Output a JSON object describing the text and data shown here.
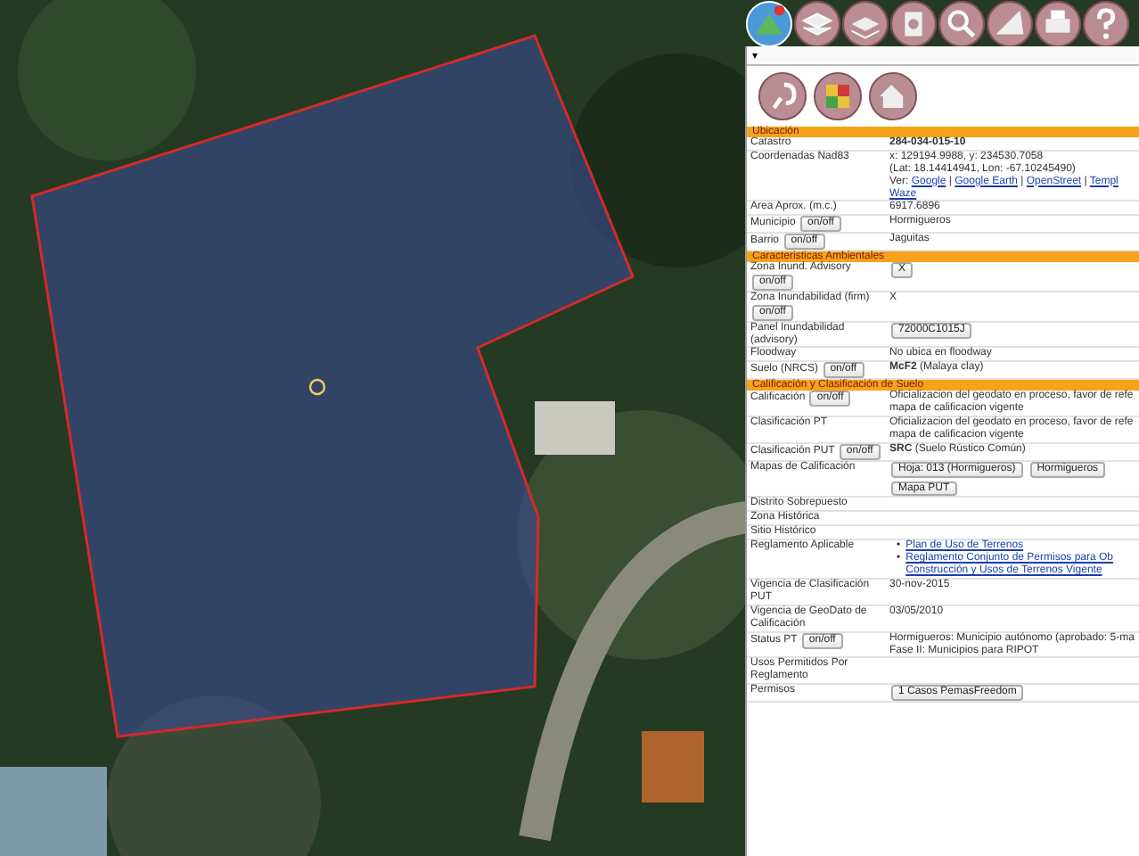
{
  "panel": {
    "dropdown_marker": "▾",
    "sections": [
      {
        "title": "Ubicación",
        "rows": [
          {
            "label": "Catastro",
            "kind": "text",
            "bold": true,
            "value": "284-034-015-10"
          },
          {
            "label": "Coordenadas Nad83",
            "kind": "coords",
            "lines": [
              "x: 129194.9988, y: 234530.7058",
              "(Lat: 18.14414941, Lon: -67.10245490)"
            ],
            "links_prefix": "Ver:",
            "links_separator": "|",
            "links": [
              "Google",
              "Google Earth",
              "OpenStreet",
              "Templ",
              "Waze"
            ]
          },
          {
            "label": "Area Aprox. (m.c.)",
            "kind": "text",
            "value": "6917.6896"
          },
          {
            "label": "Municipio",
            "toggle": "on/off",
            "kind": "text",
            "value": "Hormigueros"
          },
          {
            "label": "Barrio",
            "toggle": "on/off",
            "kind": "text",
            "value": "Jaguitas"
          }
        ]
      },
      {
        "title": "Caracteristicas Ambientales",
        "rows": [
          {
            "label": "Zona Inund. Advisory",
            "toggle": "on/off",
            "kind": "buttons",
            "buttons": [
              "X"
            ]
          },
          {
            "label": "Zona Inundabilidad (firm)",
            "toggle": "on/off",
            "kind": "text",
            "value": "X"
          },
          {
            "label": "Panel Inundabilidad (advisory)",
            "kind": "buttons",
            "buttons": [
              "72000C1015J"
            ]
          },
          {
            "label": "Floodway",
            "kind": "text",
            "value": "No ubica en floodway"
          },
          {
            "label": "Suelo (NRCS)",
            "toggle": "on/off",
            "kind": "text",
            "value": "**McF2** (Malaya clay)"
          }
        ]
      },
      {
        "title": "Calificación y Clasificación de Suelo",
        "rows": [
          {
            "label": "Calificación",
            "toggle": "on/off",
            "kind": "lines",
            "lines": [
              "Oficializacion del geodato en proceso, favor de refe",
              "mapa de calificacion vigente"
            ]
          },
          {
            "label": "Clasificación PT",
            "kind": "lines",
            "lines": [
              "Oficializacion del geodato en proceso, favor de refe",
              "mapa de calificacion vigente"
            ]
          },
          {
            "label": "Clasificación PUT",
            "toggle": "on/off",
            "kind": "text",
            "value": "**SRC** (Suelo Rústico Común)"
          },
          {
            "label": "Mapas de Calificación",
            "kind": "buttons",
            "buttons": [
              "Hoja: 013 (Hormigueros)",
              "Hormigueros",
              "Mapa PUT"
            ]
          },
          {
            "label": "Distrito Sobrepuesto",
            "kind": "text"
          },
          {
            "label": "Zona Histórica",
            "kind": "text"
          },
          {
            "label": "Sitio Histórico",
            "kind": "text"
          },
          {
            "label": "Reglamento Aplicable",
            "kind": "links",
            "bullet": "•",
            "links": [
              [
                "Plan de Uso de Terrenos"
              ],
              [
                "Reglamento Conjunto de Permisos para Ob",
                "Construcción y Usos de Terrenos Vigente"
              ]
            ]
          },
          {
            "label": "Vigencia de Clasificación PUT",
            "kind": "text",
            "value": "30-nov-2015"
          },
          {
            "label": "Vigencia de GeoDato de Calificación",
            "kind": "text",
            "value": "03/05/2010"
          },
          {
            "label": "Status PT",
            "toggle": "on/off",
            "kind": "lines",
            "lines": [
              "Hormigueros: Municipio autónomo (aprobado: 5-ma",
              "Fase II: Municipios para RIPOT"
            ]
          },
          {
            "label": "Usos Permitidos Por Reglamento",
            "kind": "text"
          },
          {
            "label": "Permisos",
            "kind": "buttons",
            "buttons": [
              "1 Casos PemasFreedom"
            ]
          }
        ]
      }
    ]
  }
}
